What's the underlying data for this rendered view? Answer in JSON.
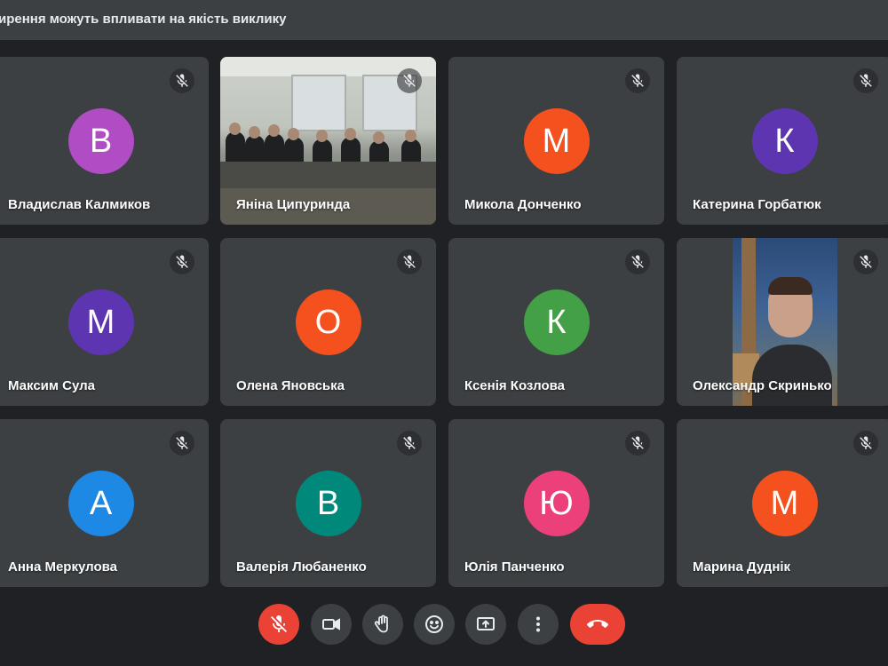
{
  "banner": {
    "text": "ирення можуть впливати на якість виклику"
  },
  "participants": [
    {
      "name": "Владислав Калмиков",
      "initial": "В",
      "color": "#b04dc4"
    },
    {
      "name": "Яніна Ципуринда",
      "video": "classroom"
    },
    {
      "name": "Микола Донченко",
      "initial": "М",
      "color": "#f4511e"
    },
    {
      "name": "Катерина Горбатюк",
      "initial": "К",
      "color": "#5e35b1"
    },
    {
      "name": "Максим Сула",
      "initial": "М",
      "color": "#5e35b1"
    },
    {
      "name": "Олена Яновська",
      "initial": "О",
      "color": "#f4511e"
    },
    {
      "name": "Ксенія Козлова",
      "initial": "К",
      "color": "#43a047"
    },
    {
      "name": "Олександр Скринько",
      "video": "selfie"
    },
    {
      "name": "Анна Меркулова",
      "initial": "А",
      "color": "#1e88e5"
    },
    {
      "name": "Валерія Любаненко",
      "initial": "В",
      "color": "#00897b"
    },
    {
      "name": "Юлія Панченко",
      "initial": "Ю",
      "color": "#ec407a"
    },
    {
      "name": "Марина Дуднік",
      "initial": "М",
      "color": "#f4511e"
    }
  ],
  "controls": {
    "mic": {
      "icon": "mic-off-icon",
      "color": "#ea4335"
    },
    "camera": {
      "icon": "video-camera-icon"
    },
    "raise_hand": {
      "icon": "hand-icon"
    },
    "reactions": {
      "icon": "emoji-icon"
    },
    "present": {
      "icon": "present-screen-icon"
    },
    "more": {
      "icon": "more-vert-icon"
    },
    "end_call": {
      "icon": "phone-hangup-icon",
      "color": "#ea4335"
    }
  },
  "colors": {
    "background": "#202124",
    "tile": "#3c4043",
    "danger": "#ea4335"
  }
}
